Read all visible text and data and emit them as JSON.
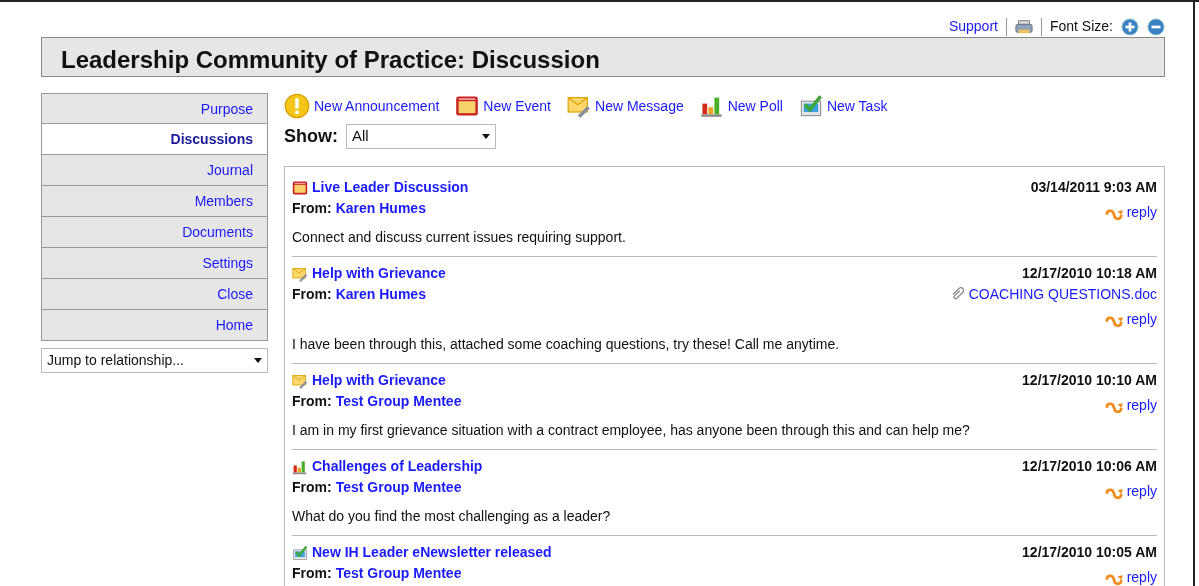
{
  "top_bar": {
    "support_link": "Support",
    "font_size_label": "Font Size:"
  },
  "title": "Leadership Community of Practice: Discussion",
  "sidebar": {
    "items": [
      {
        "label": "Purpose",
        "selected": false
      },
      {
        "label": "Discussions",
        "selected": true
      },
      {
        "label": "Journal",
        "selected": false
      },
      {
        "label": "Members",
        "selected": false
      },
      {
        "label": "Documents",
        "selected": false
      },
      {
        "label": "Settings",
        "selected": false
      },
      {
        "label": "Close",
        "selected": false
      },
      {
        "label": "Home",
        "selected": false
      }
    ],
    "jump": {
      "value": "Jump to relationship..."
    }
  },
  "toolbar": [
    {
      "kind": "announcement",
      "label": "New Announcement"
    },
    {
      "kind": "event",
      "label": "New Event"
    },
    {
      "kind": "message",
      "label": "New Message"
    },
    {
      "kind": "poll",
      "label": "New Poll"
    },
    {
      "kind": "task",
      "label": "New Task"
    }
  ],
  "filter": {
    "label": "Show:",
    "value": "All"
  },
  "posts": [
    {
      "kind": "event",
      "title": "Live Leader Discussion",
      "from_label": "From:",
      "author": "Karen Humes",
      "date": "03/14/2011 9:03 AM",
      "reply": "reply",
      "body": "Connect and discuss current issues requiring support."
    },
    {
      "kind": "message",
      "title": "Help with Grievance",
      "from_label": "From:",
      "author": "Karen Humes",
      "date": "12/17/2010 10:18 AM",
      "attachment": "COACHING QUESTIONS.doc",
      "reply": "reply",
      "body": "I have been through this, attached some coaching questions, try these! Call me anytime."
    },
    {
      "kind": "message",
      "title": "Help with Grievance",
      "from_label": "From:",
      "author": "Test Group Mentee",
      "date": "12/17/2010 10:10 AM",
      "reply": "reply",
      "body": "I am in my first grievance situation with a contract employee, has anyone been through this and can help me?"
    },
    {
      "kind": "poll",
      "title": "Challenges of Leadership",
      "from_label": "From:",
      "author": "Test Group Mentee",
      "date": "12/17/2010 10:06 AM",
      "reply": "reply",
      "body": "What do you find the most challenging as a leader?"
    },
    {
      "kind": "task",
      "title": "New IH Leader eNewsletter released",
      "from_label": "From:",
      "author": "Test Group Mentee",
      "date": "12/17/2010 10:05 AM",
      "reply": "reply"
    }
  ]
}
